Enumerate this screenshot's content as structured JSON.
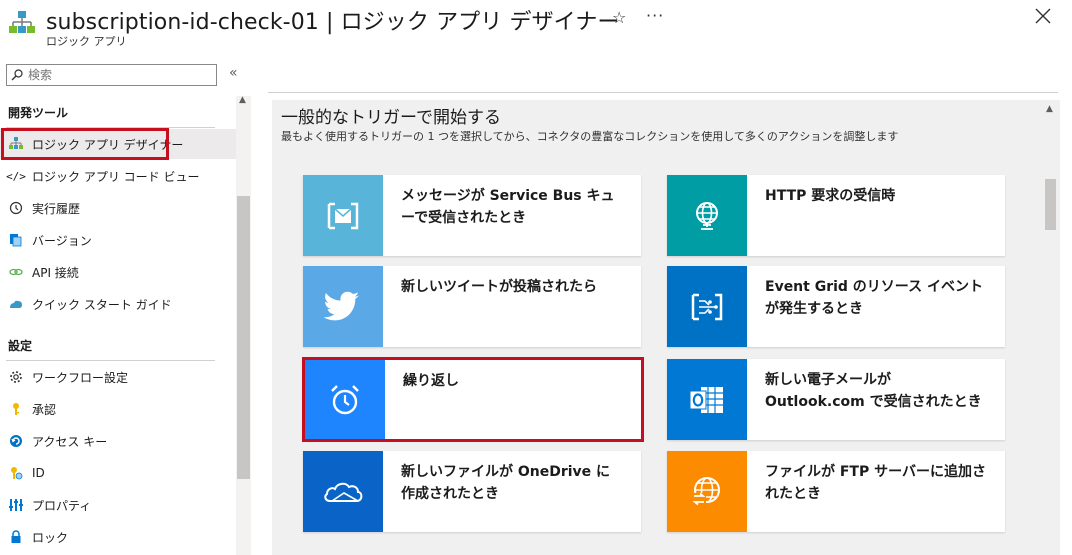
{
  "header": {
    "title": "subscription-id-check-01 | ロジック アプリ デザイナー",
    "subtitle": "ロジック アプリ",
    "star_glyph": "☆",
    "more_glyph": "···",
    "close_icon": "close-icon"
  },
  "sidebar": {
    "search_placeholder": "検索",
    "collapse_glyph": "«",
    "sections": [
      {
        "title": "開発ツール",
        "items": [
          {
            "label": "ロジック アプリ デザイナー",
            "icon": "logic-app-designer-icon",
            "active": true
          },
          {
            "label": "ロジック アプリ コード ビュー",
            "icon": "code-view-icon"
          },
          {
            "label": "実行履歴",
            "icon": "history-icon"
          },
          {
            "label": "バージョン",
            "icon": "versions-icon"
          },
          {
            "label": "API 接続",
            "icon": "api-connection-icon"
          },
          {
            "label": "クイック スタート ガイド",
            "icon": "quickstart-icon"
          }
        ]
      },
      {
        "title": "設定",
        "items": [
          {
            "label": "ワークフロー設定",
            "icon": "gear-icon"
          },
          {
            "label": "承認",
            "icon": "key-icon"
          },
          {
            "label": "アクセス キー",
            "icon": "access-key-icon"
          },
          {
            "label": "ID",
            "icon": "identity-icon"
          },
          {
            "label": "プロパティ",
            "icon": "properties-icon"
          },
          {
            "label": "ロック",
            "icon": "lock-icon"
          }
        ]
      }
    ]
  },
  "main": {
    "heading": "一般的なトリガーで開始する",
    "description": "最もよく使用するトリガーの 1 つを選択してから、コネクタの豊富なコレクションを使用して多くのアクションを調整します",
    "triggers": [
      {
        "label": "メッセージが Service Bus キューで受信されたとき",
        "icon": "service-bus-icon",
        "color": "#59b4d9"
      },
      {
        "label": "HTTP 要求の受信時",
        "icon": "http-request-icon",
        "color": "#009da5"
      },
      {
        "label": "新しいツイートが投稿されたら",
        "icon": "twitter-icon",
        "color": "#5aa9e6"
      },
      {
        "label": "Event Grid のリソース イベントが発生するとき",
        "icon": "event-grid-icon",
        "color": "#0072c6"
      },
      {
        "label": "繰り返し",
        "icon": "recurrence-clock-icon",
        "color": "#1f85ff"
      },
      {
        "label": "新しい電子メールが Outlook.com で受信されたとき",
        "icon": "outlook-icon",
        "color": "#0078d4"
      },
      {
        "label": "新しいファイルが OneDrive に作成されたとき",
        "icon": "onedrive-icon",
        "color": "#0a64c8"
      },
      {
        "label": "ファイルが FTP サーバーに追加されたとき",
        "icon": "ftp-icon",
        "color": "#fc8b00"
      }
    ]
  }
}
